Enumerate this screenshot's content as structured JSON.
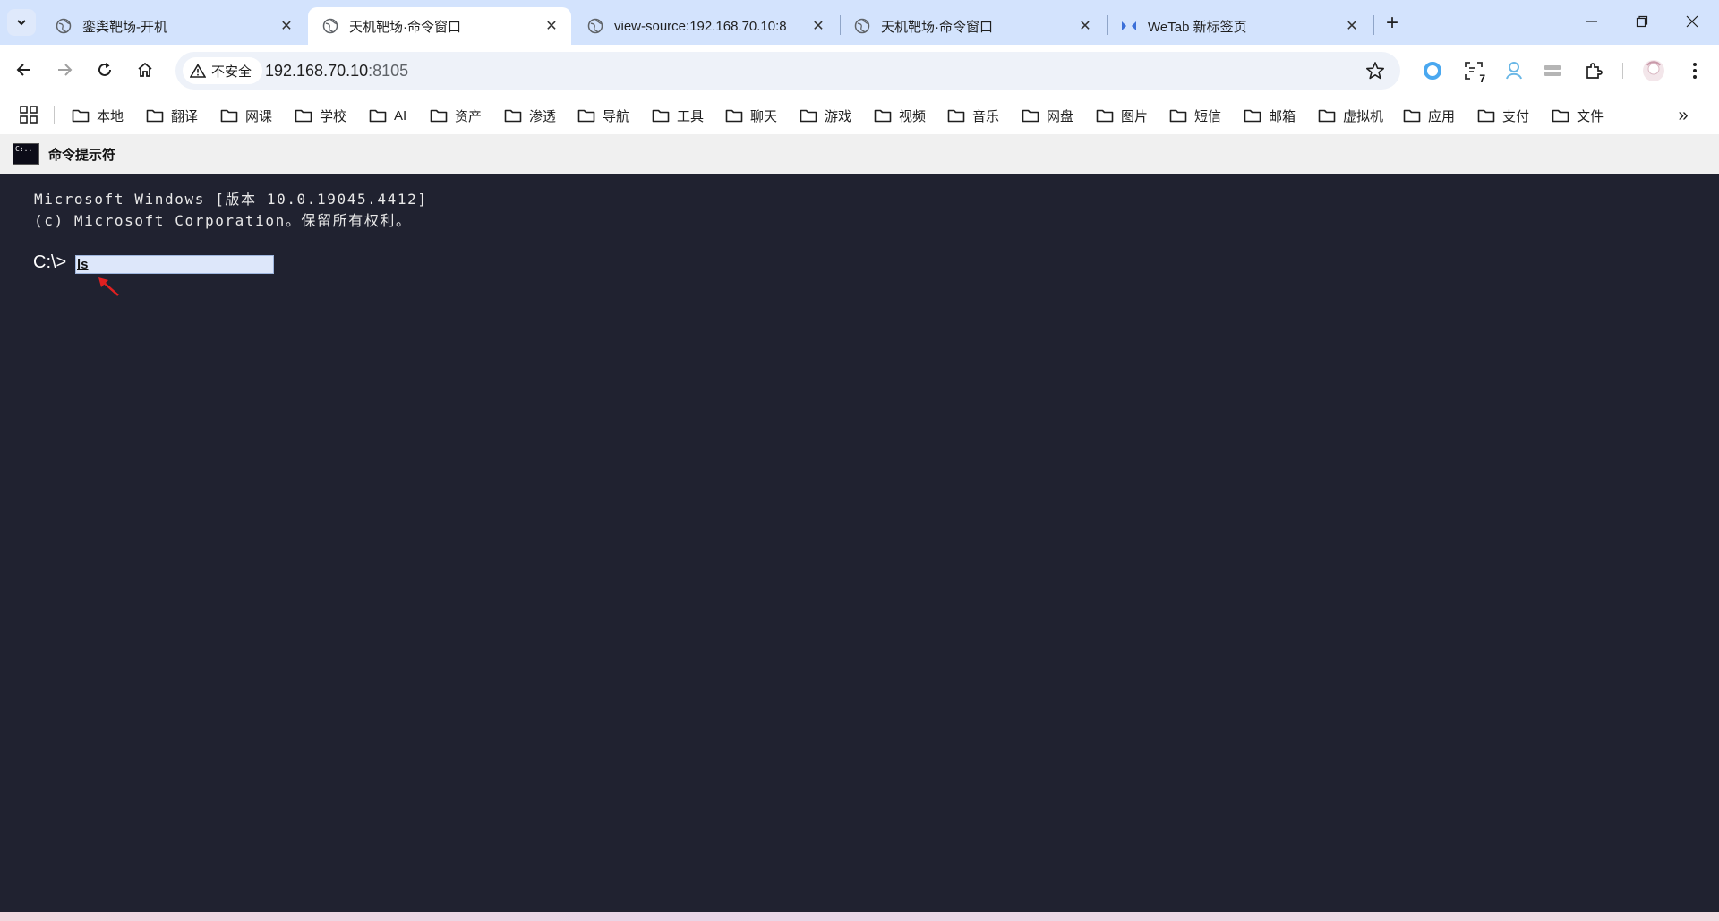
{
  "browser": {
    "tabs": [
      {
        "title": "銮舆靶场-开机",
        "active": false
      },
      {
        "title": "天机靶场·命令窗口",
        "active": true
      },
      {
        "title": "view-source:192.168.70.10:8",
        "active": false
      },
      {
        "title": "天机靶场·命令窗口",
        "active": false
      },
      {
        "title": "WeTab 新标签页",
        "active": false
      }
    ],
    "security_label": "不安全",
    "url_host": "192.168.70.10",
    "url_port": ":8105",
    "extension_badge": "7",
    "bookmarks": [
      "本地",
      "翻译",
      "网课",
      "学校",
      "AI",
      "资产",
      "渗透",
      "导航",
      "工具",
      "聊天",
      "游戏",
      "视频",
      "音乐",
      "网盘",
      "图片",
      "短信",
      "邮箱",
      "虚拟机",
      "应用",
      "支付",
      "文件"
    ]
  },
  "page": {
    "app_title": "命令提示符",
    "icon_text": "C:..",
    "banner_line1": "Microsoft Windows [版本 10.0.19045.4412]",
    "banner_line2": "(c) Microsoft Corporation。保留所有权利。",
    "prompt": "C:\\>",
    "input_value": "ls"
  },
  "colors": {
    "tabstrip": "#d3e3fd",
    "terminal_bg": "#202230",
    "input_bg": "#dde7fa",
    "arrow": "#e02020"
  }
}
